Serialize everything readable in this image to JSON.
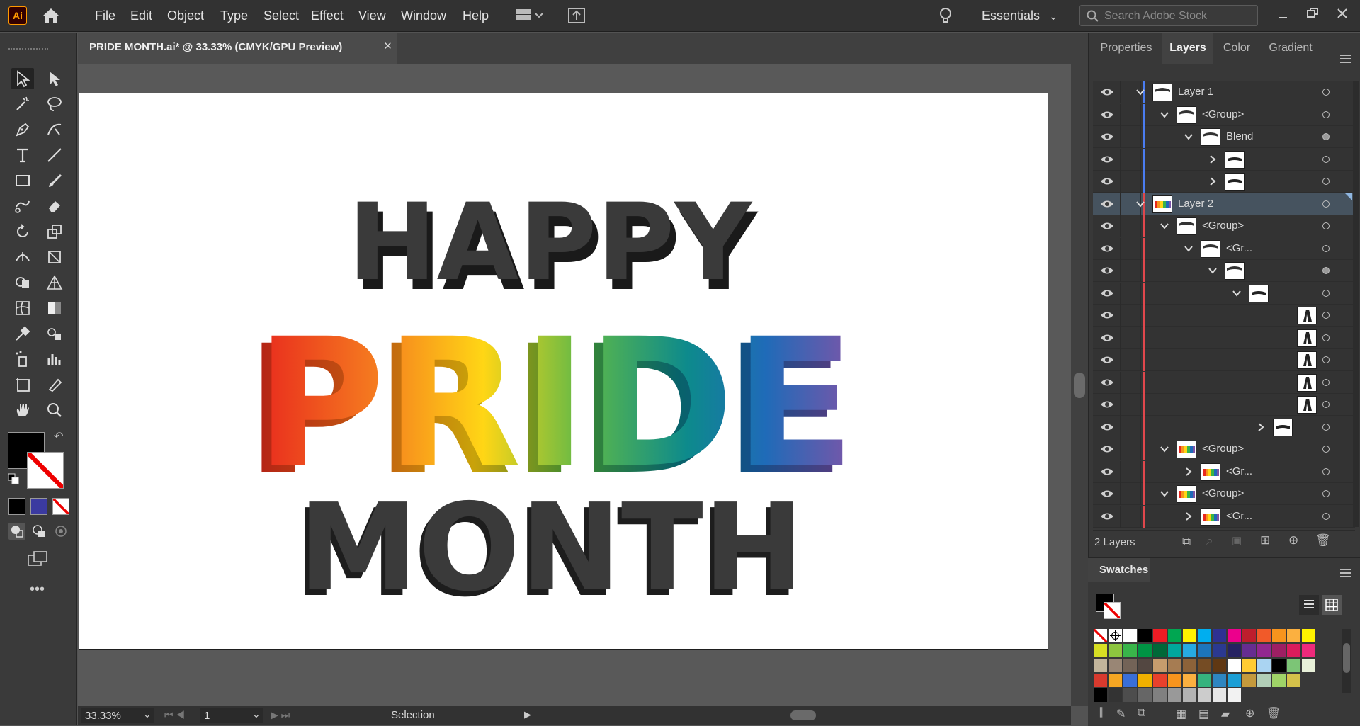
{
  "app": {
    "logo": "Ai"
  },
  "menu": [
    "File",
    "Edit",
    "Object",
    "Type",
    "Select",
    "Effect",
    "View",
    "Window",
    "Help"
  ],
  "workspace": {
    "label": "Essentials"
  },
  "search": {
    "placeholder": "Search Adobe Stock"
  },
  "document": {
    "tab_title": "PRIDE MONTH.ai* @ 33.33% (CMYK/GPU Preview)",
    "close": "×"
  },
  "artwork": {
    "line1": "HAPPY",
    "line2": "PRIDE",
    "line3": "MONTH"
  },
  "status": {
    "zoom": "33.33%",
    "page": "1",
    "tool": "Selection"
  },
  "panel_tabs": [
    "Properties",
    "Layers",
    "Color",
    "Gradient"
  ],
  "active_panel_tab": "Layers",
  "layers": [
    {
      "name": "Layer 1",
      "indent": 0,
      "expanded": true,
      "color": "#4a7cf0",
      "target": "empty",
      "thumb": "wave"
    },
    {
      "name": "<Group>",
      "indent": 1,
      "expanded": true,
      "color": "#4a7cf0",
      "target": "empty",
      "thumb": "wave"
    },
    {
      "name": "Blend",
      "indent": 2,
      "expanded": true,
      "color": "#4a7cf0",
      "target": "filled",
      "thumb": "wave"
    },
    {
      "name": "",
      "indent": 3,
      "expanded": false,
      "color": "#4a7cf0",
      "target": "empty",
      "thumb": "text"
    },
    {
      "name": "",
      "indent": 3,
      "expanded": false,
      "color": "#4a7cf0",
      "target": "empty",
      "thumb": "text"
    },
    {
      "name": "Layer 2",
      "indent": 0,
      "expanded": true,
      "color": "#e0474c",
      "target": "empty",
      "thumb": "rainbow",
      "selected": true
    },
    {
      "name": "<Group>",
      "indent": 1,
      "expanded": true,
      "color": "#e0474c",
      "target": "empty",
      "thumb": "wave"
    },
    {
      "name": "<Gr...",
      "indent": 2,
      "expanded": true,
      "color": "#e0474c",
      "target": "empty",
      "thumb": "wave"
    },
    {
      "name": "",
      "indent": 3,
      "expanded": true,
      "color": "#e0474c",
      "target": "filled",
      "thumb": "wave"
    },
    {
      "name": "",
      "indent": 4,
      "expanded": true,
      "color": "#e0474c",
      "target": "empty",
      "thumb": "text"
    },
    {
      "name": "",
      "indent": 6,
      "expanded": null,
      "color": "#e0474c",
      "target": "empty",
      "thumb": "glyph"
    },
    {
      "name": "",
      "indent": 6,
      "expanded": null,
      "color": "#e0474c",
      "target": "empty",
      "thumb": "glyph"
    },
    {
      "name": "",
      "indent": 6,
      "expanded": null,
      "color": "#e0474c",
      "target": "empty",
      "thumb": "glyph"
    },
    {
      "name": "",
      "indent": 6,
      "expanded": null,
      "color": "#e0474c",
      "target": "empty",
      "thumb": "glyph"
    },
    {
      "name": "",
      "indent": 6,
      "expanded": null,
      "color": "#e0474c",
      "target": "empty",
      "thumb": "glyph"
    },
    {
      "name": "",
      "indent": 5,
      "expanded": false,
      "color": "#e0474c",
      "target": "empty",
      "thumb": "text"
    },
    {
      "name": "<Group>",
      "indent": 1,
      "expanded": true,
      "color": "#e0474c",
      "target": "empty",
      "thumb": "rainbow"
    },
    {
      "name": "<Gr...",
      "indent": 2,
      "expanded": false,
      "color": "#e0474c",
      "target": "empty",
      "thumb": "rainbow"
    },
    {
      "name": "<Group>",
      "indent": 1,
      "expanded": true,
      "color": "#e0474c",
      "target": "empty",
      "thumb": "rainbow"
    },
    {
      "name": "<Gr...",
      "indent": 2,
      "expanded": false,
      "color": "#e0474c",
      "target": "empty",
      "thumb": "rainbow"
    }
  ],
  "layers_footer": {
    "count": "2 Layers"
  },
  "swatches": {
    "title": "Swatches",
    "rows": [
      [
        "none",
        "reg",
        "#ffffff",
        "#000000",
        "#ed1c24",
        "#00a651",
        "#fff200",
        "#00aeef",
        "#2e3192",
        "#ec008c",
        "#be1e2d",
        "#f15a29",
        "#f7941d",
        "#fbb040",
        "#fff200"
      ],
      [
        "#d7df23",
        "#8dc63f",
        "#39b54a",
        "#009444",
        "#006838",
        "#00a79d",
        "#27aae1",
        "#1c75bc",
        "#2b3990",
        "#262262",
        "#662d91",
        "#92278f",
        "#9e1f63",
        "#da1c5c",
        "#ee2a7b"
      ],
      [
        "#c2b59b",
        "#998675",
        "#736357",
        "#534741",
        "#c69c6d",
        "#a67c52",
        "#8c6239",
        "#754c24",
        "#603813",
        "#ffffff",
        "#ffcc33",
        "#aad4f2",
        "#000000",
        "#7cc576",
        "#e8f0d8"
      ],
      [
        "#d83a2e",
        "#f5a623",
        "#3a6fd8",
        "#f0b000",
        "#e8412c",
        "#f7941d",
        "#fbb040",
        "#36b37e",
        "#2e86c1",
        "#1c9fd6",
        "#c49a3c",
        "#b1ceb7",
        "#a0d468",
        "#d4c14a"
      ],
      [
        "#000000",
        "#333333",
        "#4d4d4d",
        "#666666",
        "#808080",
        "#999999",
        "#b3b3b3",
        "#cccccc",
        "#e6e6e6",
        "#f2f2f2"
      ]
    ]
  }
}
